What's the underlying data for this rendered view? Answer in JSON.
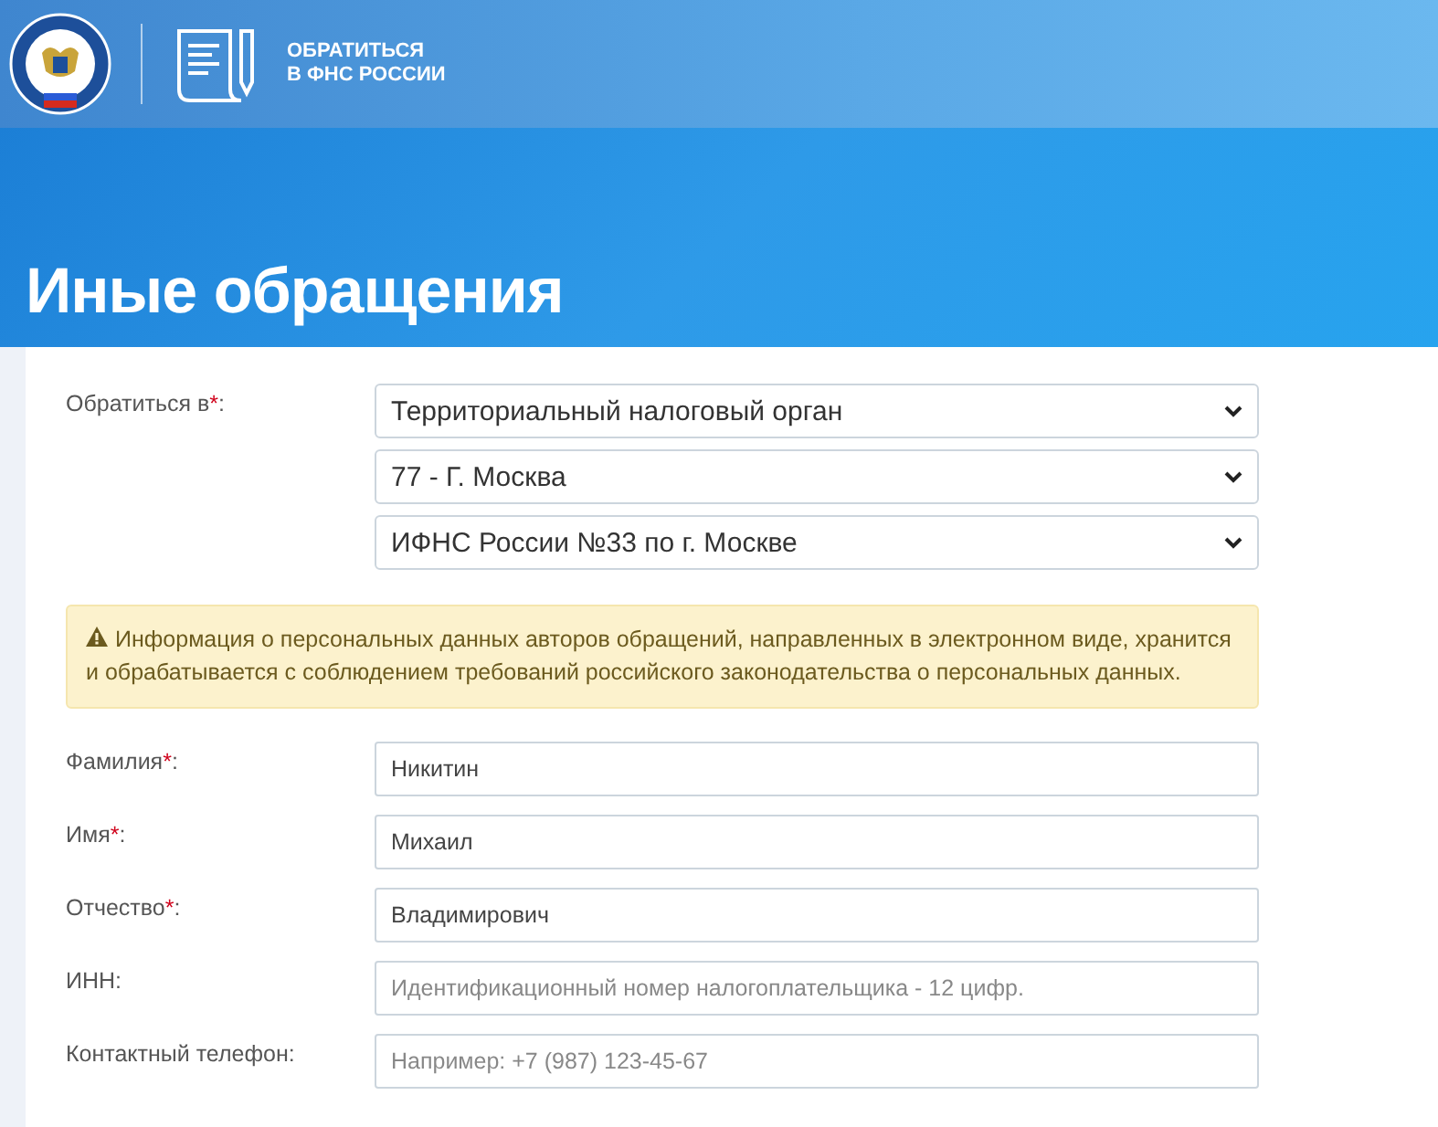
{
  "header": {
    "service_title_lines": [
      "ОБРАТИТЬСЯ",
      "В ФНС РОССИИ"
    ]
  },
  "page_title": "Иные обращения",
  "recipient": {
    "label": "Обратиться в",
    "required_mark": "*",
    "suffix": ":",
    "selects": [
      {
        "value": "Территориальный налоговый орган"
      },
      {
        "value": "77 - Г. Москва"
      },
      {
        "value": "ИФНС России №33 по г. Москве"
      }
    ]
  },
  "notice": "Информация о персональных данных авторов обращений, направленных в электронном виде, хранится и обрабатывается с соблюдением требований российского законодательства о персональных данных.",
  "fields": [
    {
      "label": "Фамилия",
      "required_mark": "*",
      "suffix": ":",
      "value": "Никитин"
    },
    {
      "label": "Имя",
      "required_mark": "*",
      "suffix": ":",
      "value": "Михаил"
    },
    {
      "label": "Отчество",
      "required_mark": "*",
      "suffix": ":",
      "value": "Владимирович"
    },
    {
      "label": "ИНН",
      "suffix": ":",
      "placeholder": "Идентификационный номер налогоплательщика - 12 цифр."
    },
    {
      "label": "Контактный телефон",
      "suffix": ":",
      "placeholder": "Например: +7 (987) 123-45-67"
    }
  ]
}
